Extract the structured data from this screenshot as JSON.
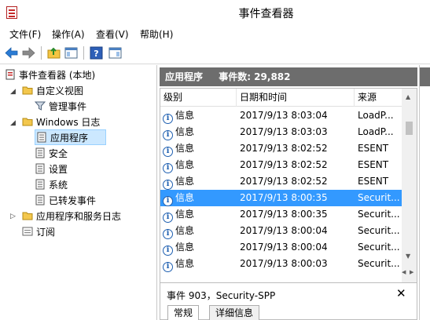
{
  "window": {
    "title": "事件查看器"
  },
  "menu": [
    "文件(F)",
    "操作(A)",
    "查看(V)",
    "帮助(H)"
  ],
  "tree": {
    "items": [
      {
        "label": "事件查看器 (本地)",
        "expander": ""
      },
      {
        "label": "自定义视图",
        "expander": "◢"
      },
      {
        "label": "管理事件",
        "expander": ""
      },
      {
        "label": "Windows 日志",
        "expander": "◢"
      },
      {
        "label": "应用程序",
        "expander": ""
      },
      {
        "label": "安全",
        "expander": ""
      },
      {
        "label": "设置",
        "expander": ""
      },
      {
        "label": "系统",
        "expander": ""
      },
      {
        "label": "已转发事件",
        "expander": ""
      },
      {
        "label": "应用程序和服务日志",
        "expander": "▷"
      },
      {
        "label": "订阅",
        "expander": ""
      }
    ]
  },
  "center": {
    "header_name": "应用程序",
    "header_count": "事件数: 29,882",
    "columns": [
      "级别",
      "日期和时间",
      "来源"
    ],
    "rows": [
      {
        "level": "信息",
        "datetime": "2017/9/13 8:03:04",
        "source": "LoadP..."
      },
      {
        "level": "信息",
        "datetime": "2017/9/13 8:03:03",
        "source": "LoadP..."
      },
      {
        "level": "信息",
        "datetime": "2017/9/13 8:02:52",
        "source": "ESENT"
      },
      {
        "level": "信息",
        "datetime": "2017/9/13 8:02:52",
        "source": "ESENT"
      },
      {
        "level": "信息",
        "datetime": "2017/9/13 8:02:52",
        "source": "ESENT"
      },
      {
        "level": "信息",
        "datetime": "2017/9/13 8:00:35",
        "source": "Securit..."
      },
      {
        "level": "信息",
        "datetime": "2017/9/13 8:00:35",
        "source": "Securit..."
      },
      {
        "level": "信息",
        "datetime": "2017/9/13 8:00:04",
        "source": "Securit..."
      },
      {
        "level": "信息",
        "datetime": "2017/9/13 8:00:04",
        "source": "Securit..."
      },
      {
        "level": "信息",
        "datetime": "2017/9/13 8:00:03",
        "source": "Securit..."
      }
    ],
    "selected_row": 5
  },
  "detail": {
    "title": "事件 903，Security-SPP",
    "close": "✕",
    "tabs": [
      "常规",
      "详细信息"
    ]
  },
  "colors": {
    "selection": "#3399ff",
    "header_bg": "#6d6d6d",
    "tree_selection": "#cce8ff"
  }
}
